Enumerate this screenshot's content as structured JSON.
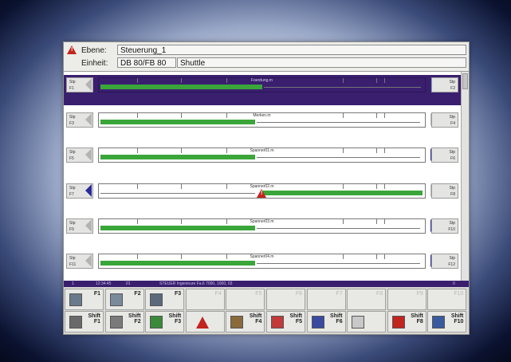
{
  "header": {
    "ebene_label": "Ebene:",
    "ebene_value": "Steuerung_1",
    "einheit_label": "Einheit:",
    "einheit_value": "DB 80/FB 80",
    "einheit_name": "Shuttle"
  },
  "rows": [
    {
      "label": "Foerdung.m",
      "left_top": "Stp",
      "left_bot": "F1",
      "right_top": "Stp",
      "right_bot": "F2",
      "progress": 0.5,
      "selected": true
    },
    {
      "label": "Merken.m",
      "left_top": "Stp",
      "left_bot": "F3",
      "right_top": "Stp",
      "right_bot": "F4",
      "progress": 0.48,
      "selected": false
    },
    {
      "label": "Spanner01.m",
      "left_top": "Stp",
      "left_bot": "F5",
      "right_top": "Stp",
      "right_bot": "F6",
      "progress": 0.48,
      "selected": false
    },
    {
      "label": "Spanner02.m",
      "left_top": "Stp",
      "left_bot": "F7",
      "right_top": "Stp",
      "right_bot": "F8",
      "progress": 0.5,
      "selected": false,
      "warning": true
    },
    {
      "label": "Spanner03.m",
      "left_top": "Stp",
      "left_bot": "F9",
      "right_top": "Stp",
      "right_bot": "F10",
      "progress": 0.48,
      "selected": false
    },
    {
      "label": "Spanner04.m",
      "left_top": "Stp",
      "left_bot": "F11",
      "right_top": "Stp",
      "right_bot": "F12",
      "progress": 0.48,
      "selected": false
    }
  ],
  "statusbar": {
    "s1": "1",
    "s2": "12:34:45",
    "s3": "01",
    "s4": "STEUER Ingenieure Fa.6  7000, 1000, 03",
    "s5": "0"
  },
  "fkeys_top": [
    {
      "label": "F1",
      "icon": "machine-icon"
    },
    {
      "label": "F2",
      "icon": "printer-icon"
    },
    {
      "label": "F3",
      "icon": "panel-icon"
    },
    {
      "label": "F4",
      "icon": "blank"
    },
    {
      "label": "F5",
      "icon": "blank"
    },
    {
      "label": "F6",
      "icon": "blank"
    },
    {
      "label": "F7",
      "icon": "blank"
    },
    {
      "label": "F8",
      "icon": "blank"
    },
    {
      "label": "F9",
      "icon": "blank"
    },
    {
      "label": "F10",
      "icon": "blank"
    }
  ],
  "fkeys_bottom": [
    {
      "label": "Shift\nF1",
      "icon": "robot-icon"
    },
    {
      "label": "Shift\nF2",
      "icon": "conveyor-icon"
    },
    {
      "label": "Shift\nF3",
      "icon": "gears-icon"
    },
    {
      "label": "",
      "icon": "warning-icon"
    },
    {
      "label": "Shift\nF4",
      "icon": "tools-icon"
    },
    {
      "label": "Shift\nF5",
      "icon": "arrow-icon"
    },
    {
      "label": "Shift\nF6",
      "icon": "counter-icon"
    },
    {
      "label": "",
      "icon": "disabled-icon"
    },
    {
      "label": "Shift\nF8",
      "icon": "display-icon"
    },
    {
      "label": "Shift\nF10",
      "icon": "door-icon"
    }
  ],
  "colors": {
    "progress": "#3aa63a",
    "selection": "#3a1f6f",
    "warning": "#c2241e"
  }
}
